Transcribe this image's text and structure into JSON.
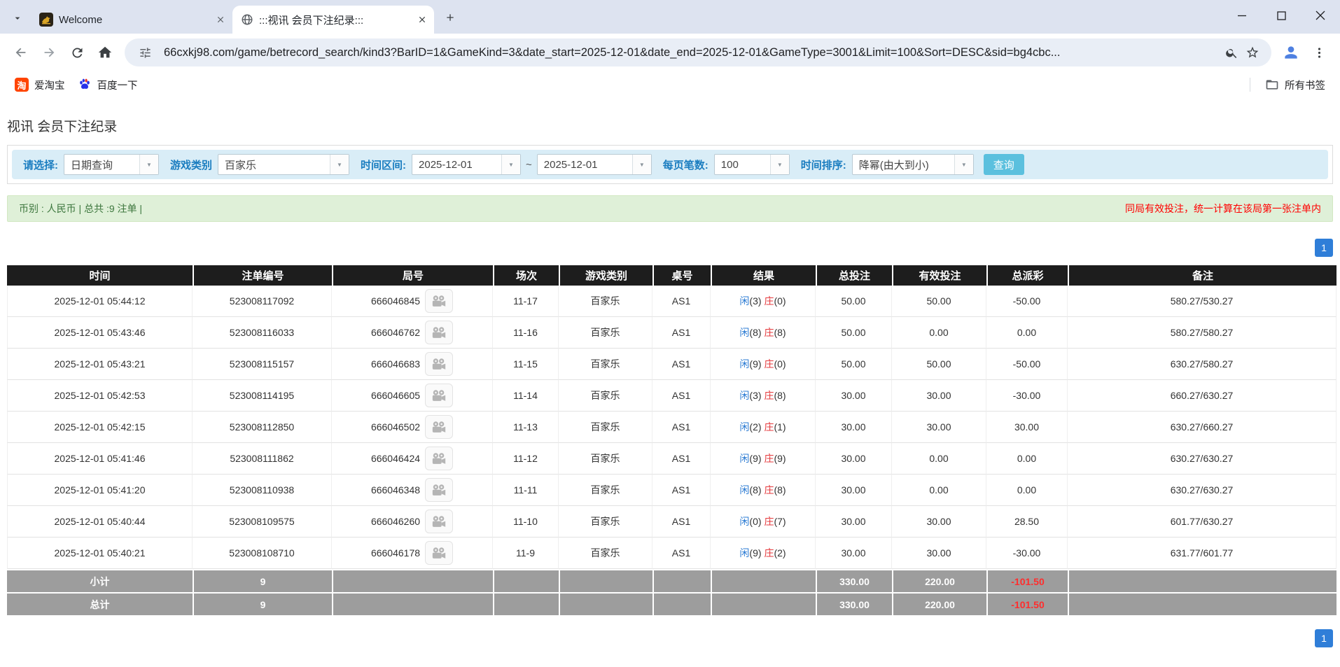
{
  "browser": {
    "tabs": [
      {
        "title": "Welcome"
      },
      {
        "title": ":::视讯 会员下注纪录:::"
      }
    ],
    "url": "66cxkj98.com/game/betrecord_search/kind3?BarID=1&GameKind=3&date_start=2025-12-01&date_end=2025-12-01&GameType=3001&Limit=100&Sort=DESC&sid=bg4cbc...",
    "bookmarks": [
      {
        "label": "爱淘宝"
      },
      {
        "label": "百度一下"
      }
    ],
    "all_bookmarks_label": "所有书签"
  },
  "page": {
    "title": "视讯 会员下注纪录",
    "filters": {
      "select_label": "请选择:",
      "select_value": "日期查询",
      "game_type_label": "游戏类别",
      "game_type_value": "百家乐",
      "date_range_label": "时间区间:",
      "date_start": "2025-12-01",
      "tilde": "~",
      "date_end": "2025-12-01",
      "per_page_label": "每页笔数:",
      "per_page_value": "100",
      "sort_label": "时间排序:",
      "sort_value": "降幂(由大到小)",
      "search_button": "查询"
    },
    "summary": {
      "left": "币别 : 人民币 | 总共 :9 注单 |",
      "right": "同局有效投注，统一计算在该局第一张注单内"
    },
    "pagination": "1",
    "table": {
      "headers": [
        "时间",
        "注单编号",
        "局号",
        "场次",
        "游戏类别",
        "桌号",
        "结果",
        "总投注",
        "有效投注",
        "总派彩",
        "备注"
      ],
      "result_player_label": "闲",
      "result_banker_label": "庄",
      "rows": [
        {
          "time": "2025-12-01 05:44:12",
          "bet_id": "523008117092",
          "round": "666046845",
          "session": "11-17",
          "game": "百家乐",
          "table_no": "AS1",
          "player_score": "(3)",
          "banker_score": "(0)",
          "total_bet": "50.00",
          "valid_bet": "50.00",
          "payout": "-50.00",
          "remark": "580.27/530.27"
        },
        {
          "time": "2025-12-01 05:43:46",
          "bet_id": "523008116033",
          "round": "666046762",
          "session": "11-16",
          "game": "百家乐",
          "table_no": "AS1",
          "player_score": "(8)",
          "banker_score": "(8)",
          "total_bet": "50.00",
          "valid_bet": "0.00",
          "payout": "0.00",
          "remark": "580.27/580.27"
        },
        {
          "time": "2025-12-01 05:43:21",
          "bet_id": "523008115157",
          "round": "666046683",
          "session": "11-15",
          "game": "百家乐",
          "table_no": "AS1",
          "player_score": "(9)",
          "banker_score": "(0)",
          "total_bet": "50.00",
          "valid_bet": "50.00",
          "payout": "-50.00",
          "remark": "630.27/580.27"
        },
        {
          "time": "2025-12-01 05:42:53",
          "bet_id": "523008114195",
          "round": "666046605",
          "session": "11-14",
          "game": "百家乐",
          "table_no": "AS1",
          "player_score": "(3)",
          "banker_score": "(8)",
          "total_bet": "30.00",
          "valid_bet": "30.00",
          "payout": "-30.00",
          "remark": "660.27/630.27"
        },
        {
          "time": "2025-12-01 05:42:15",
          "bet_id": "523008112850",
          "round": "666046502",
          "session": "11-13",
          "game": "百家乐",
          "table_no": "AS1",
          "player_score": "(2)",
          "banker_score": "(1)",
          "total_bet": "30.00",
          "valid_bet": "30.00",
          "payout": "30.00",
          "remark": "630.27/660.27"
        },
        {
          "time": "2025-12-01 05:41:46",
          "bet_id": "523008111862",
          "round": "666046424",
          "session": "11-12",
          "game": "百家乐",
          "table_no": "AS1",
          "player_score": "(9)",
          "banker_score": "(9)",
          "total_bet": "30.00",
          "valid_bet": "0.00",
          "payout": "0.00",
          "remark": "630.27/630.27"
        },
        {
          "time": "2025-12-01 05:41:20",
          "bet_id": "523008110938",
          "round": "666046348",
          "session": "11-11",
          "game": "百家乐",
          "table_no": "AS1",
          "player_score": "(8)",
          "banker_score": "(8)",
          "total_bet": "30.00",
          "valid_bet": "0.00",
          "payout": "0.00",
          "remark": "630.27/630.27"
        },
        {
          "time": "2025-12-01 05:40:44",
          "bet_id": "523008109575",
          "round": "666046260",
          "session": "11-10",
          "game": "百家乐",
          "table_no": "AS1",
          "player_score": "(0)",
          "banker_score": "(7)",
          "total_bet": "30.00",
          "valid_bet": "30.00",
          "payout": "28.50",
          "remark": "601.77/630.27"
        },
        {
          "time": "2025-12-01 05:40:21",
          "bet_id": "523008108710",
          "round": "666046178",
          "session": "11-9",
          "game": "百家乐",
          "table_no": "AS1",
          "player_score": "(9)",
          "banker_score": "(2)",
          "total_bet": "30.00",
          "valid_bet": "30.00",
          "payout": "-30.00",
          "remark": "631.77/601.77"
        }
      ],
      "subtotal": {
        "label": "小计",
        "count": "9",
        "total_bet": "330.00",
        "valid_bet": "220.00",
        "payout": "-101.50"
      },
      "total": {
        "label": "总计",
        "count": "9",
        "total_bet": "330.00",
        "valid_bet": "220.00",
        "payout": "-101.50"
      }
    },
    "colors": {
      "accent_blue": "#2f7ed8",
      "link_blue": "#2b7bd3",
      "banker_red": "#e4393c",
      "negative_red": "#ff0000",
      "search_button": "#5bc0de",
      "filter_bar_bg": "#d9edf7",
      "summary_bar_bg": "#dff0d8",
      "table_header_bg": "#1d1d1d",
      "footer_bg": "#9d9d9d"
    }
  }
}
